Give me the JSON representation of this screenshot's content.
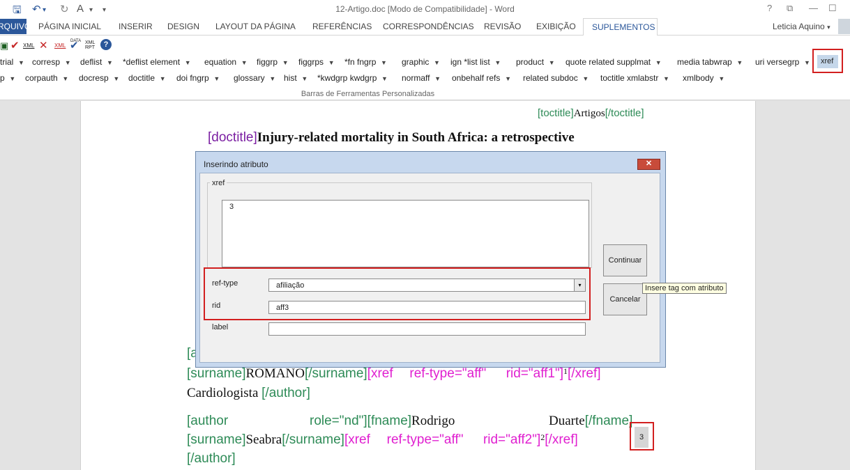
{
  "window": {
    "title": "12-Artigo.doc [Modo de Compatibilidade] - Word",
    "help": "?",
    "controls": [
      "⧉",
      "—",
      "☐"
    ]
  },
  "qat": {
    "save": "🖫",
    "undo": "↶",
    "redo": "↻",
    "format": "A",
    "more": "▾"
  },
  "tabs": {
    "file": "ARQUIVO",
    "items": [
      "PÁGINA INICIAL",
      "INSERIR",
      "DESIGN",
      "LAYOUT DA PÁGINA",
      "REFERÊNCIAS",
      "CORRESPONDÊNCIAS",
      "REVISÃO",
      "EXIBIÇÃO"
    ],
    "active": "SUPLEMENTOS",
    "user": "Leticia Aquino"
  },
  "toolbar": {
    "icons": [
      "save-xml-icon",
      "xml-icon",
      "check-icon",
      "delete-icon",
      "xml-red-icon",
      "check-blue-icon",
      "parse-icon",
      "xml-report-icon",
      "help-icon"
    ],
    "row1": [
      "trial",
      "corresp",
      "deflist",
      "*deflist element",
      "equation",
      "figgrp",
      "figgrps",
      "*fn fngrp",
      "graphic",
      "ign *list list",
      "product",
      "quote related supplmat",
      "media tabwrap",
      "uri versegrp"
    ],
    "row2": [
      "p",
      "corpauth",
      "docresp",
      "doctitle",
      "doi fngrp",
      "glossary",
      "hist",
      "*kwdgrp kwdgrp",
      "normaff",
      "onbehalf refs",
      "related subdoc",
      "toctitle xmlabstr",
      "xmlbody"
    ],
    "xref": "xref",
    "group": "Barras de Ferramentas Personalizadas"
  },
  "doc": {
    "toctitle_open": "[toctitle]",
    "toctitle_text": "Artigos",
    "toctitle_close": "[/toctitle]",
    "doctitle_open": "[doctitle]",
    "doctitle_text": "Injury-related mortality in South Africa: a retrospective",
    "line1_a": "[a",
    "surname_open": "[surname]",
    "surname1": "ROMANO",
    "surname_close": "[/surname]",
    "xref1_open": "[xref",
    "reftype_aff": "ref-type=\"aff\"",
    "rid1": "rid=\"aff1\"]",
    "sup1": "1",
    "xref_close": "[/xref]",
    "cardio": "Cardiologista",
    "author_close": "[/author]",
    "author_open": "[author",
    "role_nd": "role=\"nd\"][fname]",
    "fname": "Rodrigo",
    "fname2": "Duarte",
    "fname_close": "[/fname]",
    "surname2": "Seabra",
    "rid2": "rid=\"aff2\"]",
    "sup2": "2",
    "highlight": "3",
    "author_close2": "[/author]"
  },
  "dialog": {
    "title": "Inserindo atributo",
    "close": "✕",
    "legend": "xref",
    "textarea": "3",
    "reftype_label": "ref-type",
    "reftype_value": "afiliação",
    "reftype_arrow": "▾",
    "rid_label": "rid",
    "rid_value": "aff3",
    "label_label": "label",
    "label_value": "",
    "continue": "Continuar",
    "cancel": "Cancelar"
  },
  "tooltip": "Insere tag com atributo",
  "colors": {
    "accent": "#2b579a",
    "tag_green": "#2e8b57",
    "tag_magenta": "#e020d0",
    "tag_purple": "#7b1fa2",
    "highlight_red": "#d21f1f"
  }
}
